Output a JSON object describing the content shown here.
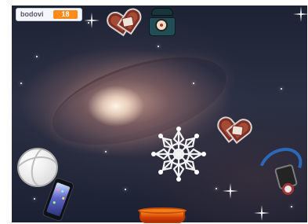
{
  "score_monitor": {
    "label": "bodovi",
    "value": "18"
  },
  "sprites": [
    {
      "name": "gingerbread-heart-icon"
    },
    {
      "name": "rotary-phone-icon"
    },
    {
      "name": "lace-snowflake-icon"
    },
    {
      "name": "gingerbread-heart-icon"
    },
    {
      "name": "volleyball-icon"
    },
    {
      "name": "smartphone-icon"
    },
    {
      "name": "orange-basket-icon"
    },
    {
      "name": "space-probe-icon"
    }
  ],
  "colors": {
    "monitor_value": "#ff8c1a",
    "heart": "#a34b35",
    "basket": "#f47d17",
    "probe_blue": "#2c68ba"
  }
}
